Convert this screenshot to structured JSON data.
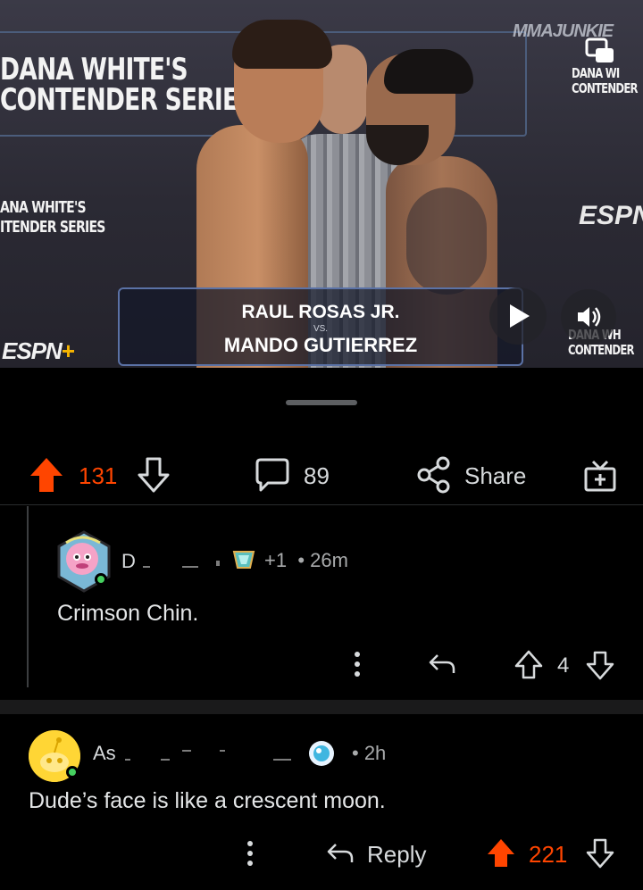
{
  "video": {
    "watermark": "MMAJUNKIE",
    "backdrop": {
      "brand_line1": "DANA WHITE'S",
      "brand_line2": "CONTENDER SERIES",
      "small_line1": "ANA WHITE'S",
      "small_line2": "ITENDER SERIES",
      "right_line1": "DANA WI",
      "right_line2": "CONTENDER",
      "bottom_right_line1": "DANA WH",
      "bottom_right_line2": "CONTENDER",
      "network": "ESPN",
      "network_plus": "+",
      "network_right": "ESPN"
    },
    "lower_third": {
      "fighter1": "RAUL ROSAS JR.",
      "vs": "VS.",
      "fighter2": "MANDO GUTIERREZ"
    },
    "controls": {
      "play_icon": "play-icon",
      "mute_icon": "volume-icon",
      "pip_icon": "picture-in-picture-icon"
    }
  },
  "post_actions": {
    "upvotes": "131",
    "upvote_color": "#ff4500",
    "comments": "89",
    "share_label": "Share"
  },
  "comments": [
    {
      "username": "D",
      "points_change": "+1",
      "time": "• 26m",
      "body": "Crimson Chin.",
      "score": "4"
    },
    {
      "username": "As",
      "time": "• 2h",
      "body": "Dude’s face is like a crescent moon.",
      "reply_label": "Reply",
      "score": "221",
      "score_color": "#ff4500"
    }
  ]
}
